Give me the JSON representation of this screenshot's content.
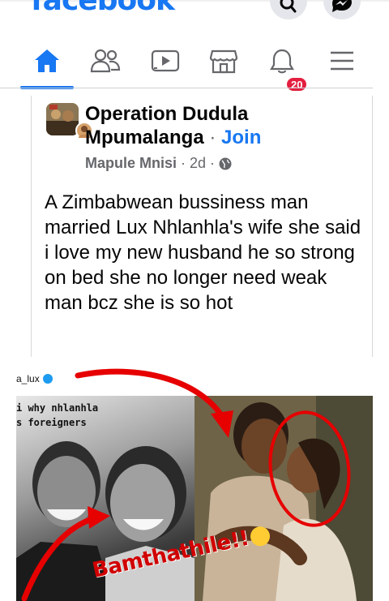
{
  "app": {
    "logo": "facebook"
  },
  "nav": {
    "items": [
      {
        "name": "home",
        "icon": "home-icon",
        "active": true
      },
      {
        "name": "friends",
        "icon": "friends-icon",
        "active": false
      },
      {
        "name": "watch",
        "icon": "video-icon",
        "active": false
      },
      {
        "name": "marketplace",
        "icon": "marketplace-icon",
        "active": false
      },
      {
        "name": "notifications",
        "icon": "bell-icon",
        "active": false
      },
      {
        "name": "menu",
        "icon": "hamburger-menu-icon",
        "active": false
      }
    ],
    "notifications_badge": "20"
  },
  "post": {
    "group_name": "Operation Dudula Mpumalanga",
    "separator": "·",
    "join_label": "Join",
    "author": "Mapule Mnisi",
    "time": "2d",
    "privacy_icon": "globe-icon",
    "text": "A Zimbabwean bussiness man married Lux Nhlanhla's wife she said i love my new husband he so strong on bed she no longer need weak man bcz she is so hot"
  },
  "photo": {
    "handle": "a_lux",
    "caption_line_1": "i why nhlanhla",
    "caption_line_2": "s foreigners",
    "scrawl_text": "Bamthathile!!"
  },
  "colors": {
    "brand": "#1877f2",
    "badge": "#e41e3f",
    "annotation_red": "#e60000",
    "text": "#050505",
    "muted": "#65676b"
  }
}
